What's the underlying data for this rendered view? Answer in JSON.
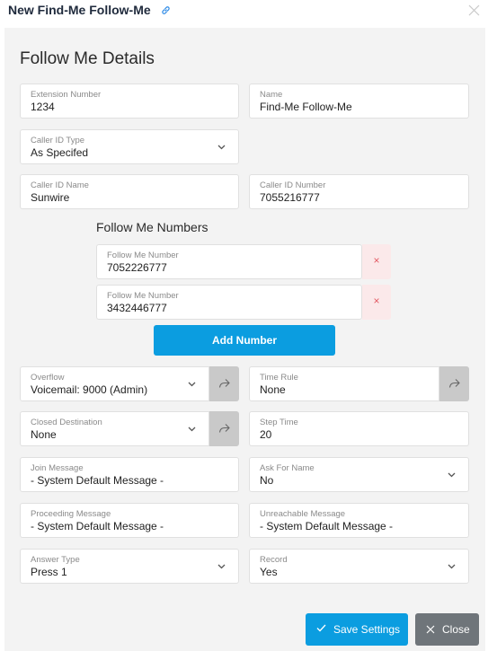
{
  "dialog": {
    "title": "New Find-Me Follow-Me"
  },
  "section_title": "Follow Me Details",
  "fields": {
    "extension_number": {
      "label": "Extension Number",
      "value": "1234"
    },
    "name": {
      "label": "Name",
      "value": "Find-Me Follow-Me"
    },
    "caller_id_type": {
      "label": "Caller ID Type",
      "value": "As Specifed"
    },
    "caller_id_name": {
      "label": "Caller ID Name",
      "value": "Sunwire"
    },
    "caller_id_number": {
      "label": "Caller ID Number",
      "value": "7055216777"
    }
  },
  "follow_me": {
    "title": "Follow Me Numbers",
    "numbers": [
      {
        "label": "Follow Me Number",
        "value": "7052226777"
      },
      {
        "label": "Follow Me Number",
        "value": "3432446777"
      }
    ],
    "remove_glyph": "×",
    "add_label": "Add Number"
  },
  "settings": {
    "overflow": {
      "label": "Overflow",
      "value": "Voicemail: 9000 (Admin)"
    },
    "time_rule": {
      "label": "Time Rule",
      "value": "None"
    },
    "closed_destination": {
      "label": "Closed Destination",
      "value": "None"
    },
    "step_time": {
      "label": "Step Time",
      "value": "20"
    },
    "join_message": {
      "label": "Join Message",
      "value": "- System Default Message -"
    },
    "ask_for_name": {
      "label": "Ask For Name",
      "value": "No"
    },
    "proceeding_message": {
      "label": "Proceeding Message",
      "value": "- System Default Message -"
    },
    "unreachable_message": {
      "label": "Unreachable Message",
      "value": "- System Default Message -"
    },
    "answer_type": {
      "label": "Answer Type",
      "value": "Press 1"
    },
    "record": {
      "label": "Record",
      "value": "Yes"
    }
  },
  "footer": {
    "save_label": "Save Settings",
    "close_label": "Close"
  },
  "colors": {
    "primary": "#0b9de0",
    "remove_bg": "#fbe9ea",
    "remove_icon": "#e25a63",
    "close_bg": "#6f757a",
    "panel_bg": "#f3f3f3"
  }
}
